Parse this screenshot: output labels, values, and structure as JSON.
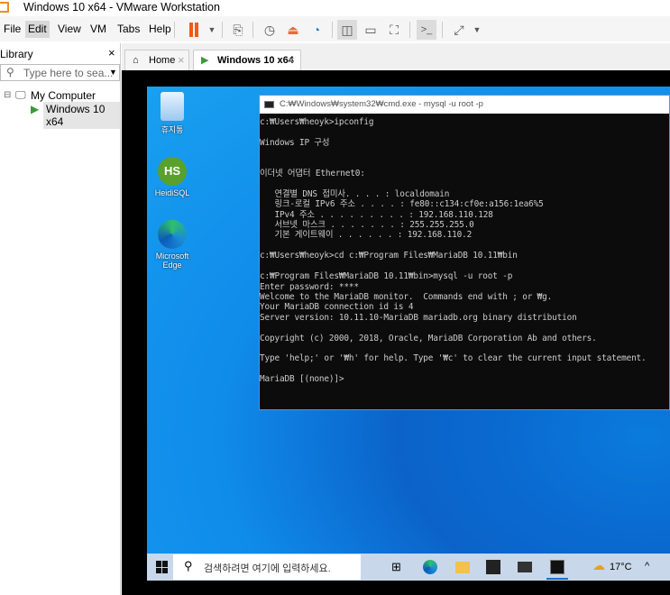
{
  "window": {
    "title": "Windows 10 x64 - VMware Workstation"
  },
  "menu": [
    "File",
    "Edit",
    "View",
    "VM",
    "Tabs",
    "Help"
  ],
  "toolbar_icons": [
    "pause-icon",
    "dropdown-icon",
    "send-keys-icon",
    "snapshot-icon",
    "revert-snapshot-icon",
    "snapshot-manager-icon",
    "library-view-icon",
    "thumbnail-bar-icon",
    "fullscreen-icon",
    "console-icon",
    "stretch-icon"
  ],
  "library": {
    "title": "Library",
    "close": "×",
    "search_placeholder": "Type here to sea...",
    "tree": {
      "root": "My Computer",
      "child": "Windows 10 x64"
    }
  },
  "tabs": [
    {
      "label": "Home",
      "close": "×"
    },
    {
      "label": "Windows 10 x64",
      "close": "×"
    }
  ],
  "desktop": {
    "icons": [
      "휴지통",
      "HeidiSQL",
      "Microsoft Edge"
    ]
  },
  "cmd": {
    "title": "C:₩Windows₩system32₩cmd.exe - mysql  -u root -p",
    "lines": [
      "c:₩Users₩heoyk>ipconfig",
      "",
      "Windows IP 구성",
      "",
      "",
      "이더넷 어댑터 Ethernet0:",
      "",
      "   연결별 DNS 접미사. . . . : localdomain",
      "   링크-로컬 IPv6 주소 . . . . : fe80::c134:cf0e:a156:1ea6%5",
      "   IPv4 주소 . . . . . . . . . : 192.168.110.128",
      "   서브넷 마스크 . . . . . . . : 255.255.255.0",
      "   기본 게이트웨이 . . . . . . : 192.168.110.2",
      "",
      "c:₩Users₩heoyk>cd c:₩Program Files₩MariaDB 10.11₩bin",
      "",
      "c:₩Program Files₩MariaDB 10.11₩bin>mysql -u root -p",
      "Enter password: ****",
      "Welcome to the MariaDB monitor.  Commands end with ; or ₩g.",
      "Your MariaDB connection id is 4",
      "Server version: 10.11.10-MariaDB mariadb.org binary distribution",
      "",
      "Copyright (c) 2000, 2018, Oracle, MariaDB Corporation Ab and others.",
      "",
      "Type 'help;' or '₩h' for help. Type '₩c' to clear the current input statement.",
      "",
      "MariaDB [(none)]>"
    ]
  },
  "taskbar": {
    "search_placeholder": "검색하려면 여기에 입력하세요.",
    "weather": "17°C",
    "tray_chevron": "^"
  }
}
